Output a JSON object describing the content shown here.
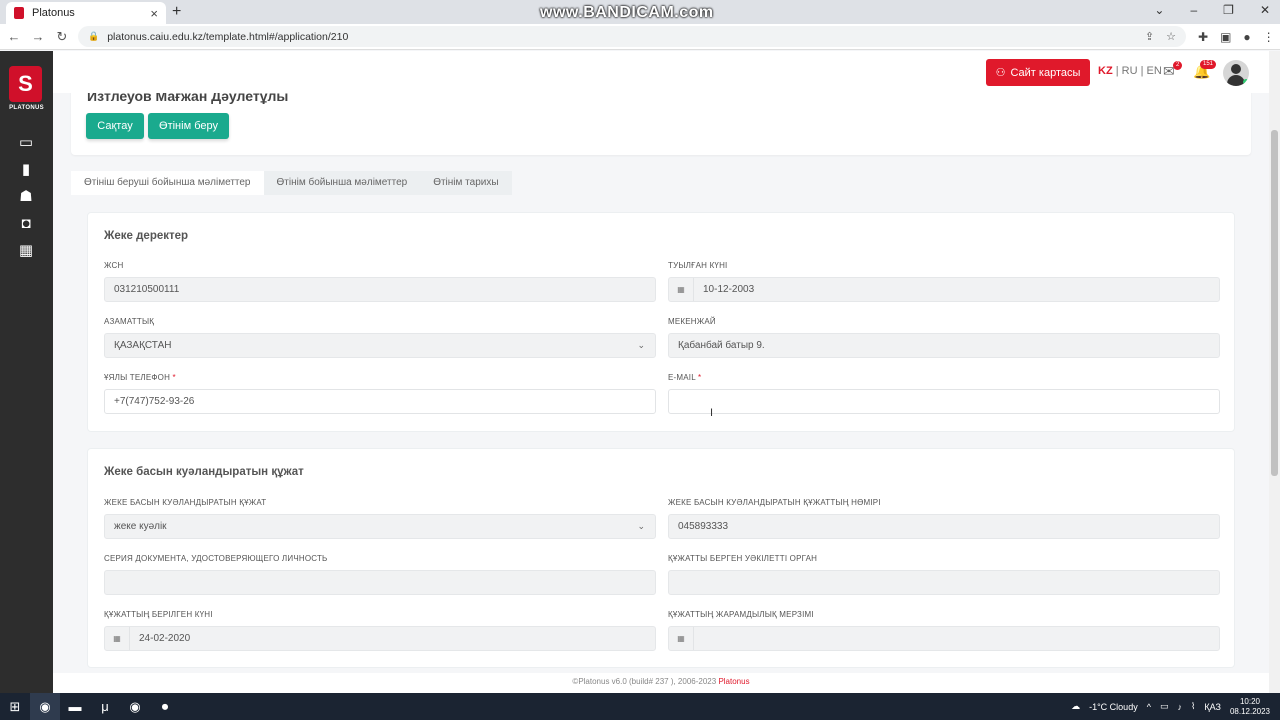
{
  "browser": {
    "tab_title": "Platonus",
    "url": "platonus.caiu.edu.kz/template.html#/application/210",
    "watermark": "www.BANDICAM.com"
  },
  "sidebar": {
    "logo_text": "PLATONUS"
  },
  "header": {
    "site_map_label": "Сайт картасы",
    "langs": [
      "KZ",
      "RU",
      "EN"
    ],
    "mail_badge": "2",
    "bell_badge": "151"
  },
  "applicant": {
    "name": "Изтлеуов Мағжан Дәулетұлы",
    "save_label": "Сақтау",
    "submit_label": "Өтінім беру"
  },
  "tabs": [
    "Өтініш беруші бойынша мәліметтер",
    "Өтінім бойынша мәліметтер",
    "Өтінім тарихы"
  ],
  "personal": {
    "title": "Жеке деректер",
    "iin_label": "ЖСН",
    "iin_value": "031210500111",
    "birthdate_label": "ТУЫЛҒАН КҮНІ",
    "birthdate_value": "10-12-2003",
    "citizenship_label": "АЗАМАТТЫҚ",
    "citizenship_value": "ҚАЗАҚСТАН",
    "address_label": "МЕКЕНЖАЙ",
    "address_value": "Қабанбай батыр 9.",
    "phone_label": "ҰЯЛЫ ТЕЛЕФОН",
    "phone_value": "+7(747)752-93-26",
    "email_label": "E-MAIL",
    "email_value": "",
    "required_mark": "*"
  },
  "identity": {
    "title": "Жеке басын куәландыратын құжат",
    "doc_type_label": "ЖЕКЕ БАСЫН КУӘЛАНДЫРАТЫН ҚҰЖАТ",
    "doc_type_value": "жеке куәлік",
    "doc_number_label": "ЖЕКЕ БАСЫН КУӘЛАНДЫРАТЫН ҚҰЖАТТЫҢ НӨМІРІ",
    "doc_number_value": "045893333",
    "series_label": "СЕРИЯ ДОКУМЕНТА, УДОСТОВЕРЯЮЩЕГО ЛИЧНОСТЬ",
    "series_value": "",
    "issuer_label": "ҚҰЖАТТЫ БЕРГЕН УӘКІЛЕТТІ ОРГАН",
    "issuer_value": "",
    "issue_date_label": "ҚҰЖАТТЫҢ БЕРІЛГЕН КҮНІ",
    "issue_date_value": "24-02-2020",
    "expiry_label": "ҚҰЖАТТЫҢ ЖАРАМДЫЛЫҚ МЕРЗІМІ",
    "expiry_value": ""
  },
  "footer": {
    "text": "©Platonus v6.0 (build# 237 ), 2006-2023",
    "brand": "Platonus"
  },
  "taskbar": {
    "weather": "-1°C  Cloudy",
    "lang": "ҚАЗ",
    "time": "10:20",
    "date": "08.12.2023"
  }
}
